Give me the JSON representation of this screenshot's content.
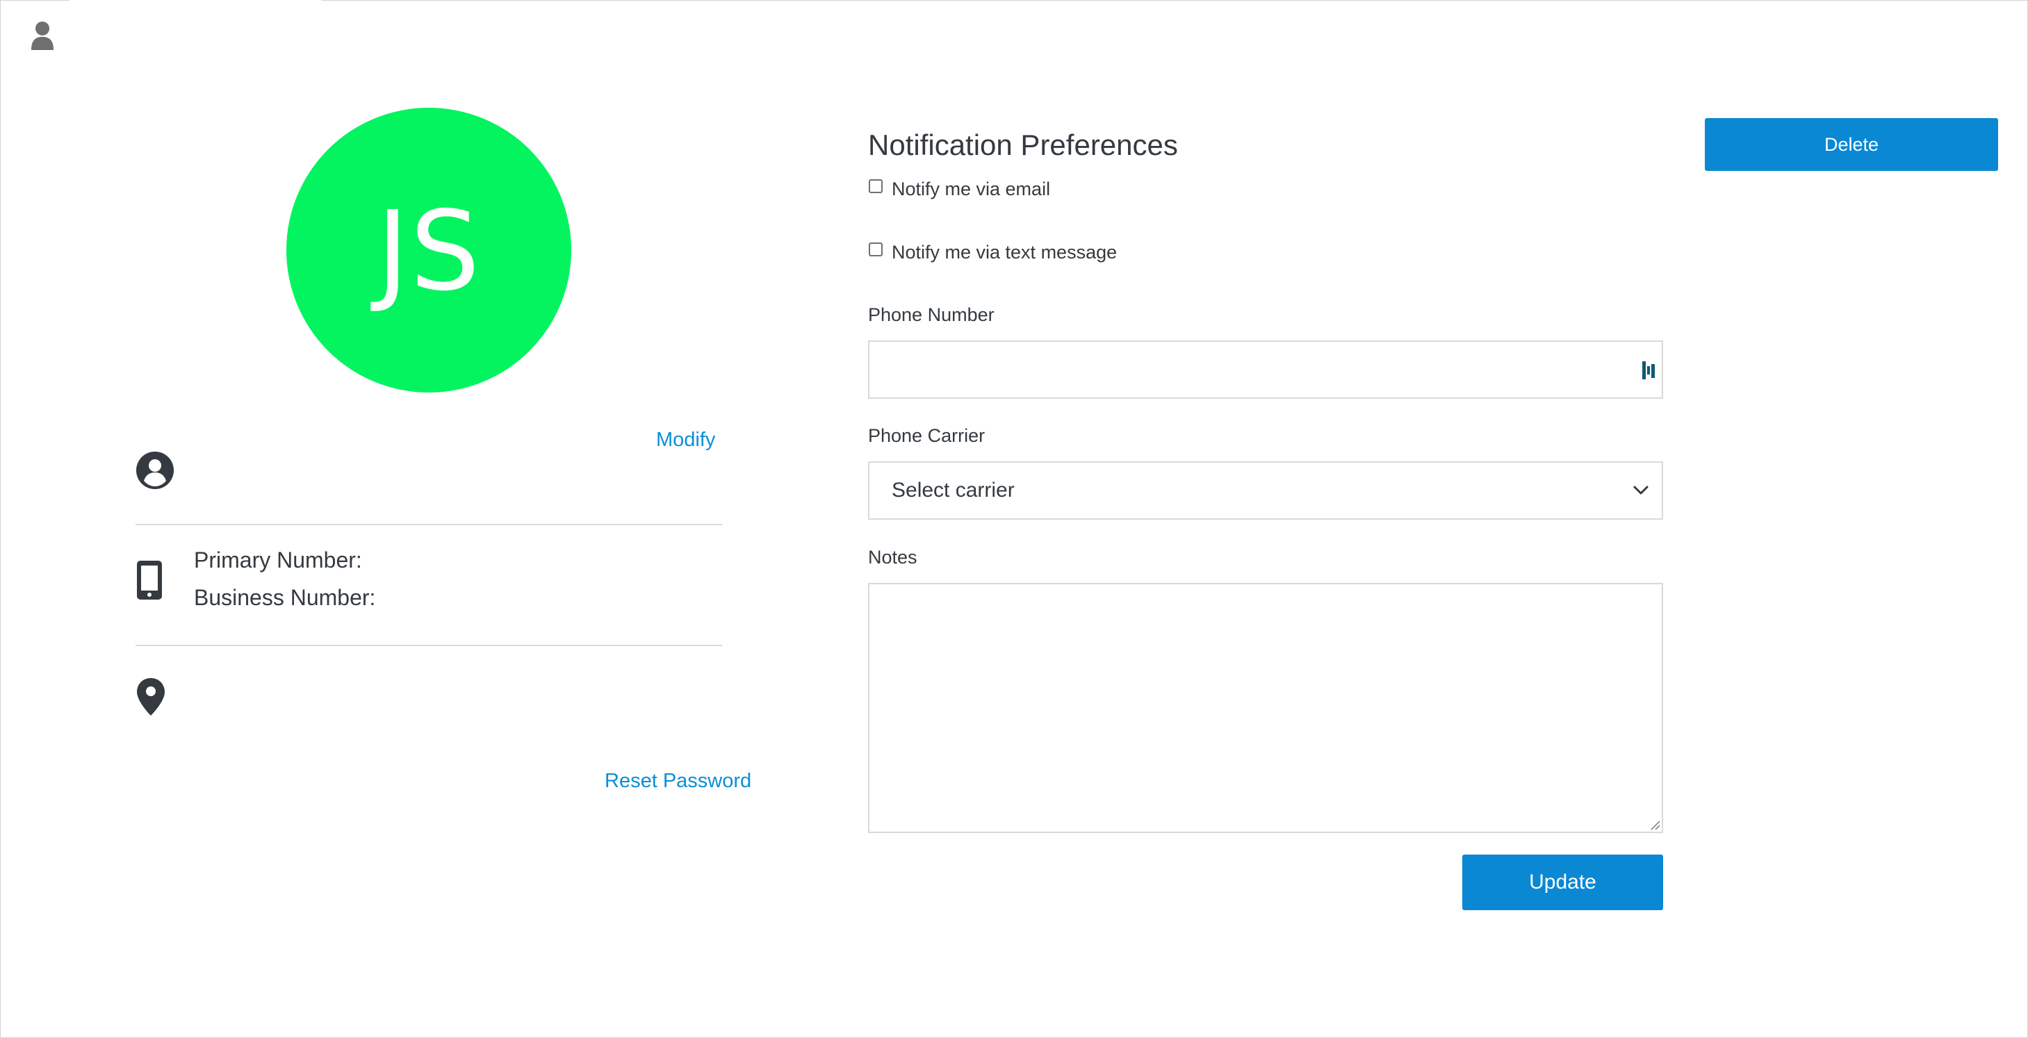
{
  "avatar": {
    "initials": "JS",
    "color": "#04f45f"
  },
  "profile": {
    "modify_label": "Modify",
    "primary_number_label": "Primary Number:",
    "business_number_label": "Business Number:",
    "reset_password_label": "Reset Password"
  },
  "notifications": {
    "title": "Notification Preferences",
    "email_label": "Notify me via email",
    "text_label": "Notify me via text message",
    "email_checked": false,
    "text_checked": false
  },
  "form": {
    "phone_number_label": "Phone Number",
    "phone_number_value": "",
    "phone_carrier_label": "Phone Carrier",
    "phone_carrier_selected": "Select carrier",
    "notes_label": "Notes",
    "notes_value": ""
  },
  "buttons": {
    "delete": "Delete",
    "update": "Update"
  },
  "icons": {
    "top_left": "user-icon",
    "profile": "account-circle-icon",
    "phone": "mobile-phone-icon",
    "location": "map-pin-icon",
    "input_helper": "password-manager-icon",
    "select_arrow": "chevron-down-icon"
  },
  "colors": {
    "accent": "#0a88d4",
    "link": "#0a8fd6",
    "text": "#343a40"
  }
}
